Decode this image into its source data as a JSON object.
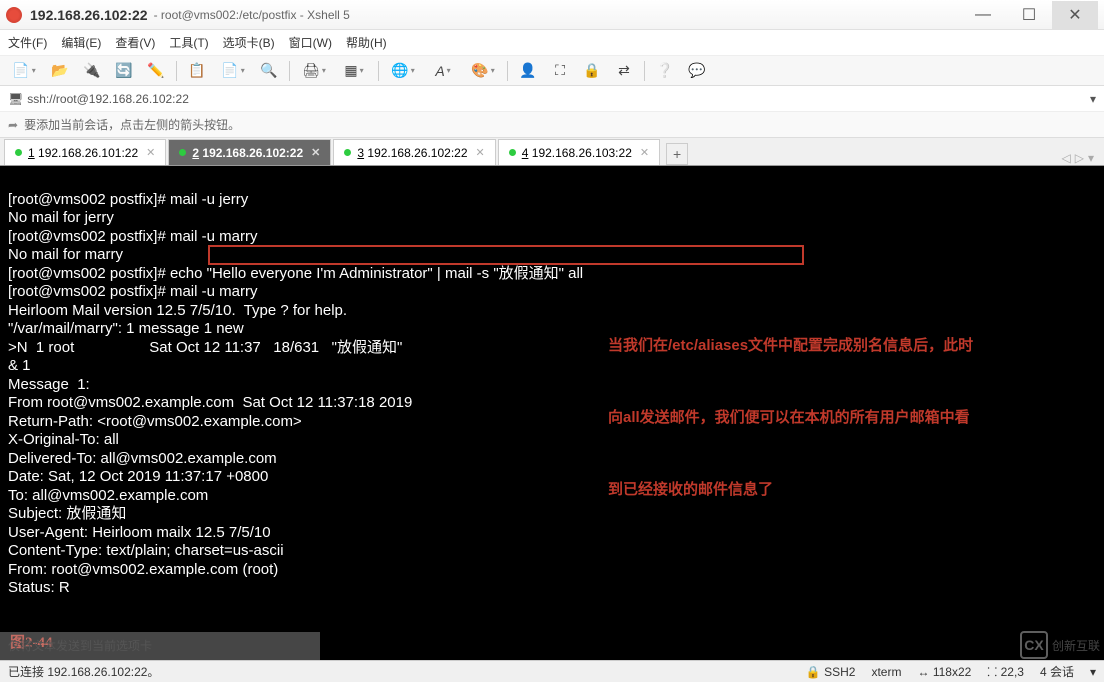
{
  "window": {
    "title_ip": "192.168.26.102:22",
    "subtitle": "root@vms002:/etc/postfix - Xshell 5"
  },
  "menu": {
    "file": "文件(F)",
    "edit": "编辑(E)",
    "view": "查看(V)",
    "tools": "工具(T)",
    "tabs": "选项卡(B)",
    "window": "窗口(W)",
    "help": "帮助(H)"
  },
  "toolbar_icons": {
    "new": "new-session-icon",
    "open": "open-icon",
    "connect": "disconnect-icon",
    "props": "properties-icon",
    "copy": "copy-icon",
    "paste": "paste-icon",
    "find": "search-icon",
    "print": "print-icon",
    "layout": "layout-icon",
    "lang": "globe-icon",
    "font": "font-icon",
    "color": "palette-icon",
    "user": "user-icon",
    "fullscreen": "fullscreen-icon",
    "lock": "lock-icon",
    "arrows": "swap-icon",
    "help": "help-icon",
    "chat": "chat-icon"
  },
  "address": {
    "url": "ssh://root@192.168.26.102:22"
  },
  "hint": {
    "text": "要添加当前会话，点击左侧的箭头按钮。"
  },
  "tabs": [
    {
      "num": "1",
      "label": "192.168.26.101:22",
      "active": false
    },
    {
      "num": "2",
      "label": "192.168.26.102:22",
      "active": true
    },
    {
      "num": "3",
      "label": "192.168.26.102:22",
      "active": false
    },
    {
      "num": "4",
      "label": "192.168.26.103:22",
      "active": false
    }
  ],
  "terminal_lines": [
    "[root@vms002 postfix]# mail -u jerry",
    "No mail for jerry",
    "[root@vms002 postfix]# mail -u marry",
    "No mail for marry",
    "[root@vms002 postfix]# echo \"Hello everyone I'm Administrator\" | mail -s \"放假通知\" all",
    "[root@vms002 postfix]# mail -u marry",
    "Heirloom Mail version 12.5 7/5/10.  Type ? for help.",
    "\"/var/mail/marry\": 1 message 1 new",
    ">N  1 root                  Sat Oct 12 11:37   18/631   \"放假通知\"",
    "& 1",
    "Message  1:",
    "From root@vms002.example.com  Sat Oct 12 11:37:18 2019",
    "Return-Path: <root@vms002.example.com>",
    "X-Original-To: all",
    "Delivered-To: all@vms002.example.com",
    "Date: Sat, 12 Oct 2019 11:37:17 +0800",
    "To: all@vms002.example.com",
    "Subject: 放假通知",
    "User-Agent: Heirloom mailx 12.5 7/5/10",
    "Content-Type: text/plain; charset=us-ascii",
    "From: root@vms002.example.com (root)",
    "Status: R"
  ],
  "annotation": {
    "l1": "当我们在/etc/aliases文件中配置完成别名信息后，此时",
    "l2": "向all发送邮件，我们便可以在本机的所有用户邮箱中看",
    "l3": "到已经接收的邮件信息了"
  },
  "figure_label": "图2-44",
  "overlay_hint": "仅将文本发送到当前选项卡",
  "statusbar": {
    "left": "已连接 192.168.26.102:22。",
    "ssh": "SSH2",
    "term": "xterm",
    "size": "118x22",
    "pos": "22,3",
    "sess": "4 会话"
  },
  "watermark": "创新互联"
}
